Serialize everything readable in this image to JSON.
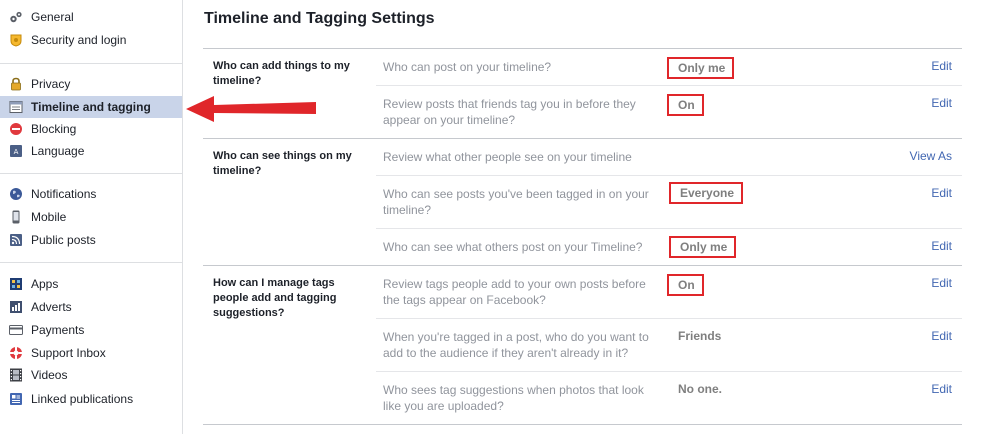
{
  "colors": {
    "accent": "#4267b2",
    "highlight": "#c9d4e9",
    "annotation_red": "#e0262a"
  },
  "sidebar": {
    "items": [
      {
        "label": "General",
        "icon": "gears-icon"
      },
      {
        "label": "Security and login",
        "icon": "badge-icon"
      },
      {
        "label": "Privacy",
        "icon": "lock-icon"
      },
      {
        "label": "Timeline and tagging",
        "icon": "timeline-icon"
      },
      {
        "label": "Blocking",
        "icon": "blocking-icon"
      },
      {
        "label": "Language",
        "icon": "language-icon"
      },
      {
        "label": "Notifications",
        "icon": "globe-icon"
      },
      {
        "label": "Mobile",
        "icon": "mobile-icon"
      },
      {
        "label": "Public posts",
        "icon": "rss-icon"
      },
      {
        "label": "Apps",
        "icon": "apps-icon"
      },
      {
        "label": "Adverts",
        "icon": "adverts-icon"
      },
      {
        "label": "Payments",
        "icon": "card-icon"
      },
      {
        "label": "Support Inbox",
        "icon": "lifebuoy-icon"
      },
      {
        "label": "Videos",
        "icon": "film-icon"
      },
      {
        "label": "Linked publications",
        "icon": "publications-icon"
      }
    ],
    "active_item": "Timeline and tagging"
  },
  "main": {
    "title": "Timeline and Tagging Settings",
    "sections": [
      {
        "heading": "Who can add things to my timeline?",
        "rows": [
          {
            "question": "Who can post on your timeline?",
            "value": "Only me",
            "action": "Edit"
          },
          {
            "question": "Review posts that friends tag you in before they appear on your timeline?",
            "value": "On",
            "action": "Edit"
          }
        ]
      },
      {
        "heading": "Who can see things on my timeline?",
        "rows": [
          {
            "question": "Review what other people see on your timeline",
            "value": "",
            "action": "View As"
          },
          {
            "question": "Who can see posts you've been tagged in on your timeline?",
            "value": "Everyone",
            "action": "Edit"
          },
          {
            "question": "Who can see what others post on your Timeline?",
            "value": "Only me",
            "action": "Edit"
          }
        ]
      },
      {
        "heading": "How can I manage tags people add and tagging suggestions?",
        "rows": [
          {
            "question": "Review tags people add to your own posts before the tags appear on Facebook?",
            "value": "On",
            "action": "Edit"
          },
          {
            "question": "When you're tagged in a post, who do you want to add to the audience if they aren't already in it?",
            "value": "Friends",
            "action": "Edit"
          },
          {
            "question": "Who sees tag suggestions when photos that look like you are uploaded?",
            "value": "No one.",
            "action": "Edit"
          }
        ]
      }
    ]
  }
}
